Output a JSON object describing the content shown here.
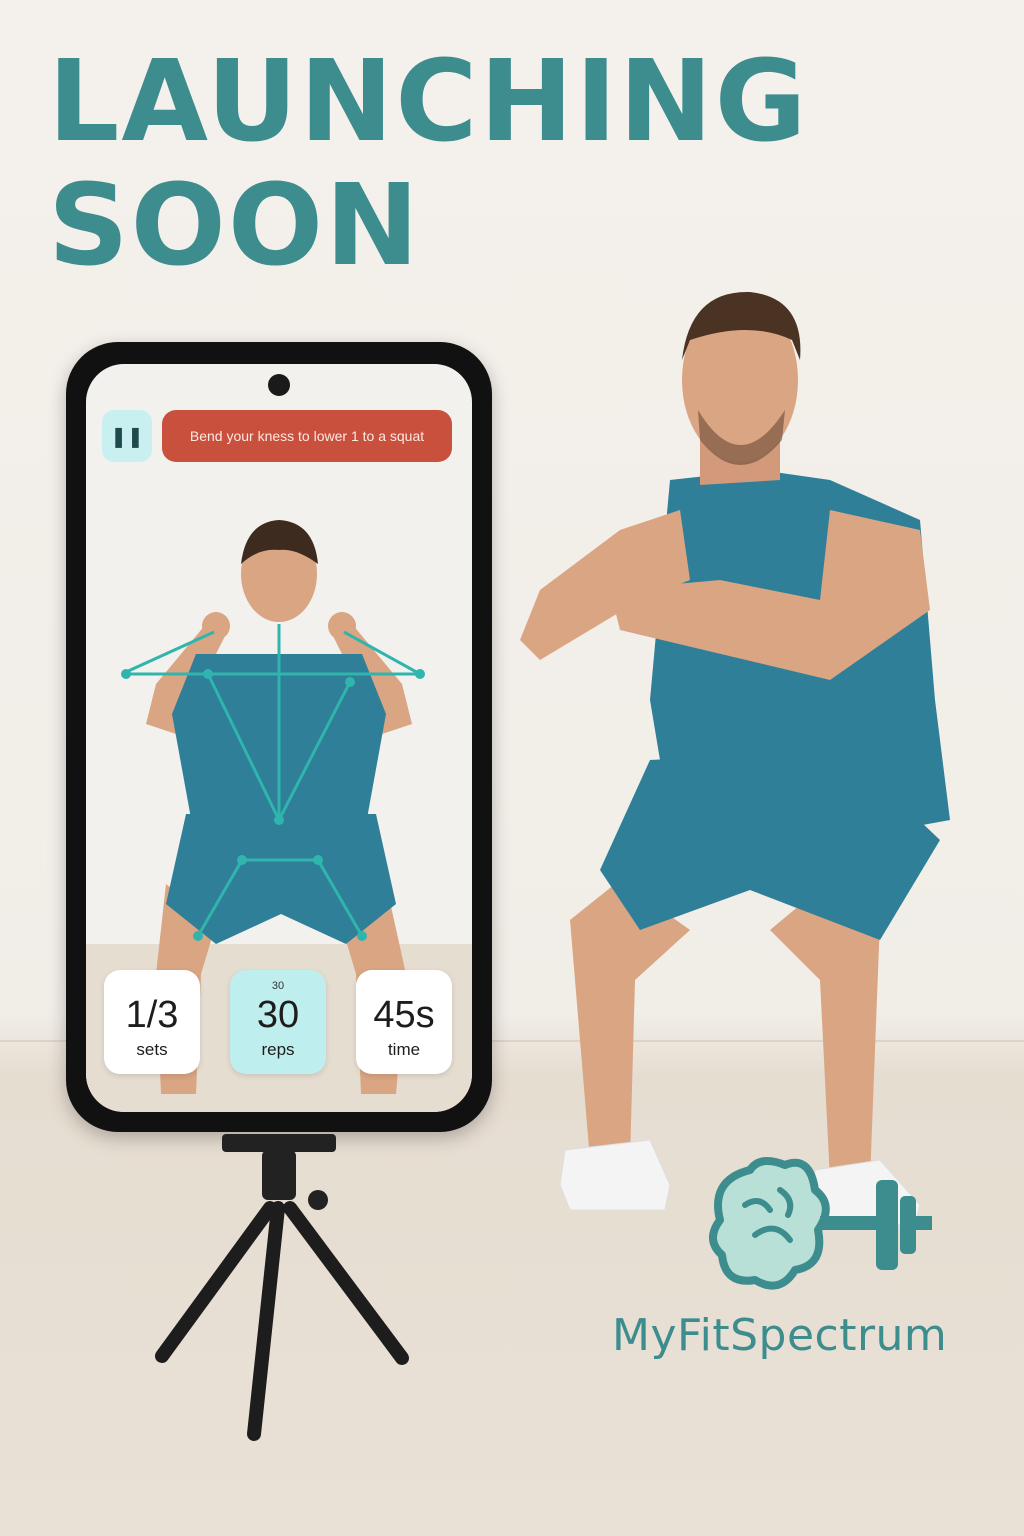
{
  "headline": {
    "line1": "LAUNCHING",
    "line2": "SOON"
  },
  "app": {
    "pause_icon": "pause-icon",
    "instruction": "Bend your kness to lower  1 to a squat",
    "stats": {
      "sets": {
        "value": "1/3",
        "label": "sets"
      },
      "reps": {
        "top": "30",
        "value": "30",
        "label": "reps"
      },
      "time": {
        "value": "45s",
        "label": "time"
      }
    }
  },
  "brand": {
    "name": "MyFitSpectrum",
    "logo_icon": "brain-dumbbell-icon"
  },
  "colors": {
    "teal": "#3d8c8e",
    "alert": "#c9503d",
    "highlight": "#bfeeee",
    "shirt": "#2f7f98"
  }
}
